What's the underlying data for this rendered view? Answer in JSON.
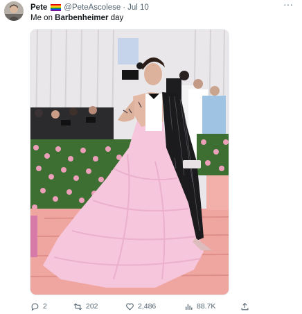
{
  "tweet": {
    "author": {
      "name": "Pete",
      "flag_icon": "rainbow-flag-icon",
      "handle": "@PeteAscolese",
      "time": "Jul 10"
    },
    "text_prefix": "Me on ",
    "text_bold": "Barbenheimer",
    "text_suffix": " day",
    "media": {
      "description_icon": "photo-icon"
    },
    "actions": {
      "replies": "2",
      "retweets": "202",
      "likes": "2,486",
      "views": "88.7K"
    },
    "more_icon": "more-horizontal-icon"
  },
  "colors": {
    "text_primary": "#0f1419",
    "text_secondary": "#536471",
    "gown_pink": "#f5c4dc",
    "carpet_pink": "#f2a9a1"
  }
}
